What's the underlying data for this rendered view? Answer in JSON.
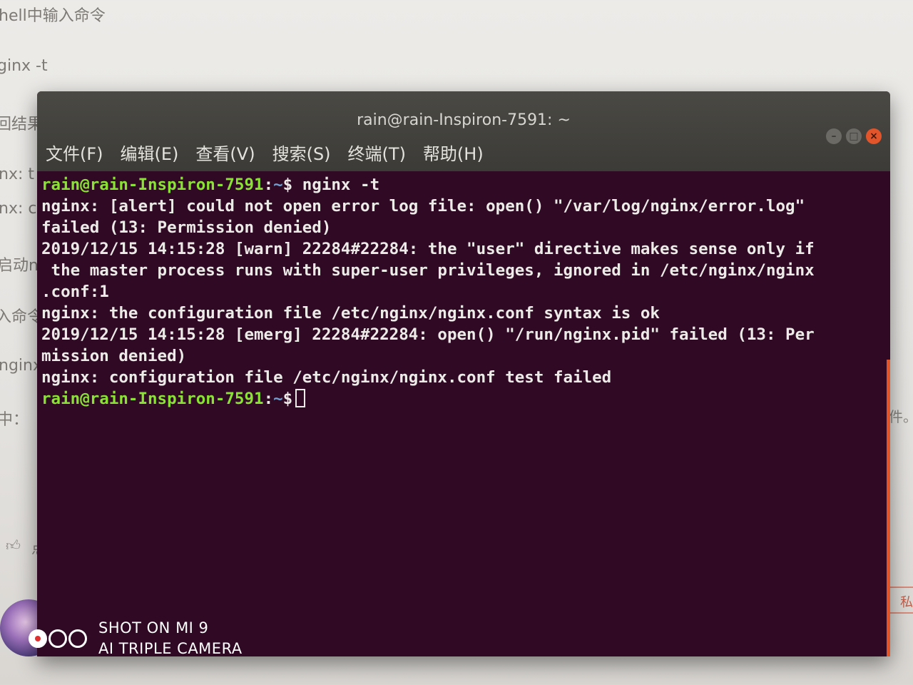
{
  "background_page": {
    "lines": [
      "hell中输入命令",
      "ginx -t",
      "回结果",
      "nx: t",
      "nx: c",
      "启动n",
      "入命令",
      "nginx",
      "中：",
      "点赞"
    ],
    "right_text": "文件。",
    "private_button": "私"
  },
  "terminal": {
    "title": "rain@rain-Inspiron-7591: ~",
    "menu": [
      "文件(F)",
      "编辑(E)",
      "查看(V)",
      "搜索(S)",
      "终端(T)",
      "帮助(H)"
    ],
    "prompt": {
      "user_host": "rain@rain-Inspiron-7591",
      "sep": ":",
      "path": "~",
      "symbol": "$"
    },
    "command": " nginx -t",
    "output": [
      "nginx: [alert] could not open error log file: open() \"/var/log/nginx/error.log\"",
      "failed (13: Permission denied)",
      "2019/12/15 14:15:28 [warn] 22284#22284: the \"user\" directive makes sense only if",
      " the master process runs with super-user privileges, ignored in /etc/nginx/nginx",
      ".conf:1",
      "nginx: the configuration file /etc/nginx/nginx.conf syntax is ok",
      "2019/12/15 14:15:28 [emerg] 22284#22284: open() \"/run/nginx.pid\" failed (13: Per",
      "mission denied)",
      "nginx: configuration file /etc/nginx/nginx.conf test failed"
    ]
  },
  "watermark": {
    "line1": "SHOT ON MI 9",
    "line2": "AI TRIPLE CAMERA"
  },
  "colors": {
    "terminal_bg": "#300a24",
    "prompt_user": "#8ae234",
    "prompt_path": "#729fcf",
    "close_button": "#e2552a"
  }
}
